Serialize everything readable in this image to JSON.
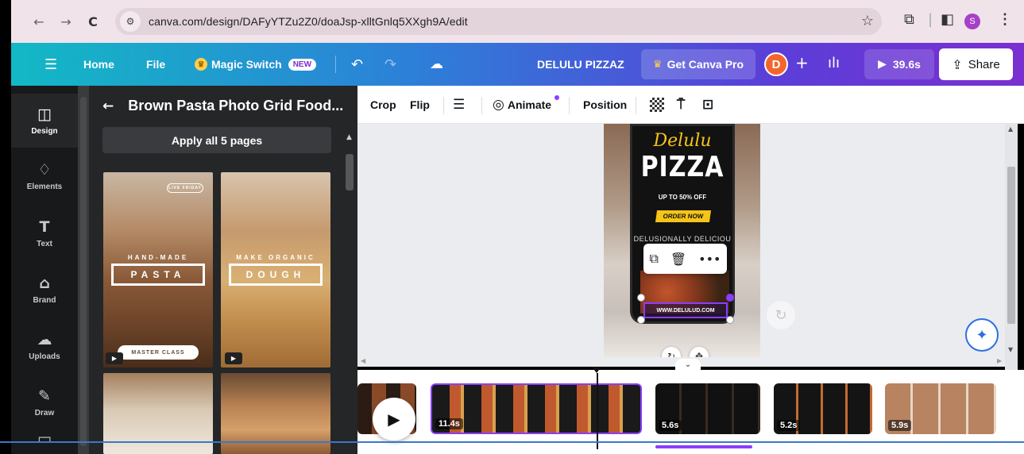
{
  "browser": {
    "url": "canva.com/design/DAFyYTZu2Z0/doaJsp-xlltGnlq5XXgh9A/edit",
    "profile_initial": "S"
  },
  "header": {
    "home": "Home",
    "file": "File",
    "magic_switch": "Magic Switch",
    "new_badge": "NEW",
    "design_title": "DELULU PIZZAZ",
    "get_pro": "Get Canva Pro",
    "avatar_initial": "D",
    "play_duration": "39.6s",
    "share": "Share"
  },
  "rail": {
    "items": [
      {
        "label": "Design",
        "icon": "layout-icon"
      },
      {
        "label": "Elements",
        "icon": "shapes-icon"
      },
      {
        "label": "Text",
        "icon": "text-icon"
      },
      {
        "label": "Brand",
        "icon": "brand-icon"
      },
      {
        "label": "Uploads",
        "icon": "upload-cloud-icon"
      },
      {
        "label": "Draw",
        "icon": "pen-icon"
      }
    ]
  },
  "panel": {
    "title": "Brown Pasta Photo Grid Food...",
    "apply_button": "Apply all 5 pages",
    "tiles": [
      {
        "badge": "LIVE FRIDAY",
        "subtitle": "HAND-MADE",
        "frame_text": "PASTA",
        "pill": "MASTER CLASS"
      },
      {
        "subtitle": "MAKE ORGANIC",
        "frame_text": "DOUGH"
      }
    ]
  },
  "toolbar": {
    "crop": "Crop",
    "flip": "Flip",
    "animate": "Animate",
    "position": "Position"
  },
  "design": {
    "script_title": "Delulu",
    "big_title": "PIZZA",
    "offer": "UP TO 50% OFF",
    "order": "ORDER NOW",
    "tagline": "DELUSIONALLY DELICIOU",
    "website": "WWW.DELULUD.COM"
  },
  "timeline": {
    "clips": [
      {
        "duration": "11.4s"
      },
      {
        "duration": "5.6s"
      },
      {
        "duration": "5.2s"
      },
      {
        "duration": "5.9s"
      }
    ]
  },
  "colors": {
    "accent_purple": "#8b3dff",
    "header_start": "#12b9c5",
    "header_end": "#7a2fd0",
    "pizza_yellow": "#f5c518"
  }
}
